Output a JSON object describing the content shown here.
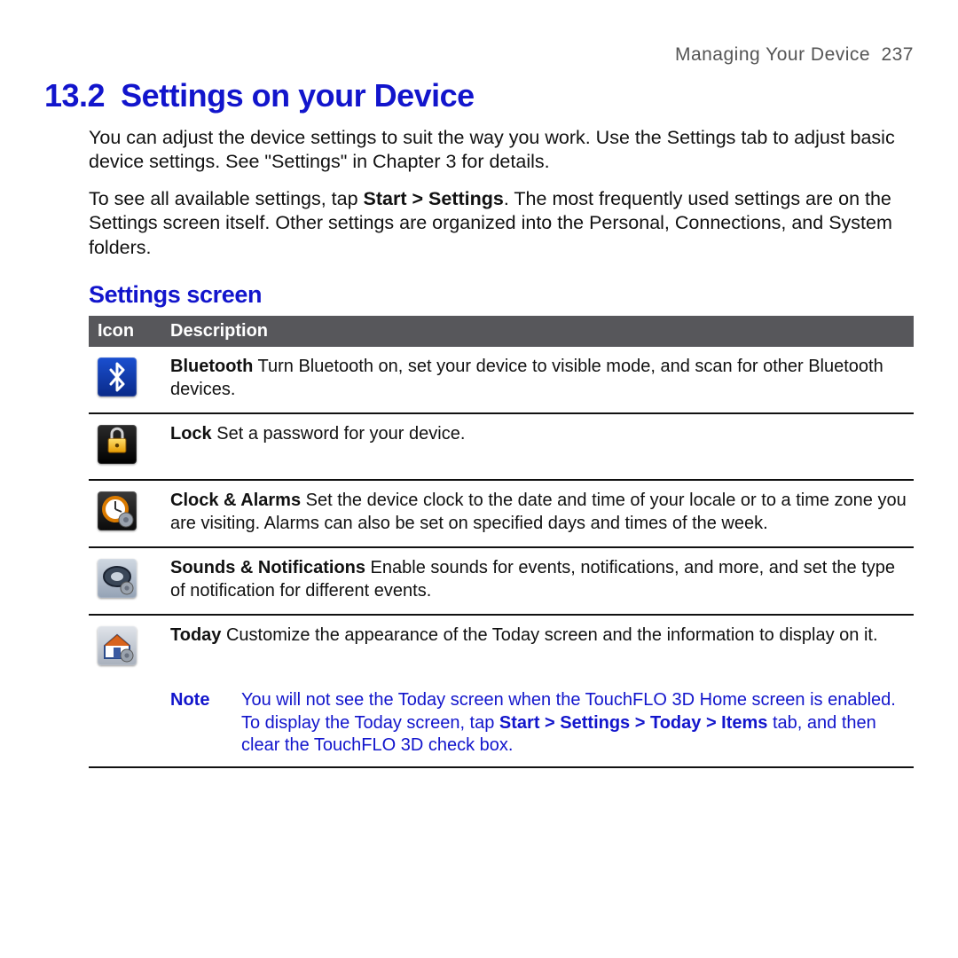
{
  "running_head": {
    "title": "Managing Your Device",
    "page": "237"
  },
  "section": {
    "number": "13.2",
    "title": "Settings on your Device"
  },
  "paragraphs": {
    "p1": "You can adjust the device settings to suit the way you work. Use the Settings tab to adjust basic device settings. See \"Settings\" in Chapter 3 for details.",
    "p2a": "To see all available settings, tap ",
    "p2b_bold": "Start > Settings",
    "p2c": ". The most frequently used settings are on the Settings screen itself. Other settings are organized into the Personal, Connections, and System folders."
  },
  "subhead": "Settings screen",
  "table": {
    "head": {
      "icon": "Icon",
      "desc": "Description"
    },
    "rows": [
      {
        "icon_name": "bluetooth-icon",
        "title": "Bluetooth",
        "desc": "  Turn Bluetooth on, set your device to visible mode, and scan for other Bluetooth devices."
      },
      {
        "icon_name": "lock-icon",
        "title": "Lock",
        "desc": "  Set a password for your device."
      },
      {
        "icon_name": "clock-alarms-icon",
        "title": "Clock & Alarms",
        "desc": "  Set the device clock to the date and time of your locale or to a time zone you are visiting. Alarms can also be set on specified days and times of the week."
      },
      {
        "icon_name": "sounds-notifications-icon",
        "title": "Sounds & Notifications",
        "desc": "  Enable sounds for events, notifications, and more, and set the type of notification for different events."
      },
      {
        "icon_name": "today-icon",
        "title": "Today",
        "desc": "  Customize the appearance of the Today screen and the information to display on it."
      }
    ],
    "note": {
      "label": "Note",
      "t1": "You will not see the Today screen when the TouchFLO 3D Home screen is enabled. To display the Today screen, tap ",
      "b1": "Start > Settings > Today > Items",
      "t2": " tab, and then clear the TouchFLO 3D check box."
    }
  }
}
